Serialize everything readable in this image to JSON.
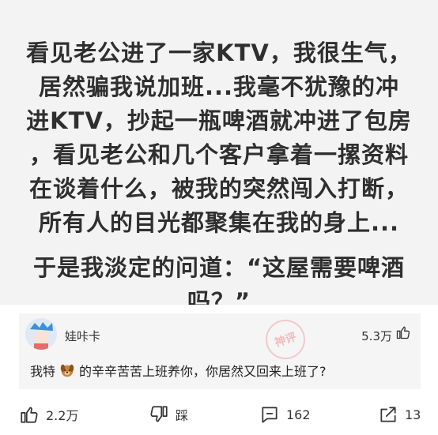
{
  "post": {
    "lines": [
      "看见老公进了一家KTV，我很生气，",
      "居然骗我说加班...我毫不犹豫的冲",
      "进KTV，抄起一瓶啤酒就冲进了包房",
      "，看见老公和几个客户拿着一摞资料",
      "在谈着什么，被我的突然闯入打断，",
      "所有人的目光都聚集在我的身上...",
      "于是我淡定的问道：“这屋需要啤酒",
      "吗？”"
    ]
  },
  "comment": {
    "username": "娃咔卡",
    "likes": "5.3万",
    "stamp_text": "神评",
    "text_before": "我特",
    "text_after": "的辛辛苦苦上班养你，你居然又回来上班了?"
  },
  "actions": {
    "like": "2.2万",
    "dislike": "踩",
    "comments": "162",
    "share": "13"
  }
}
